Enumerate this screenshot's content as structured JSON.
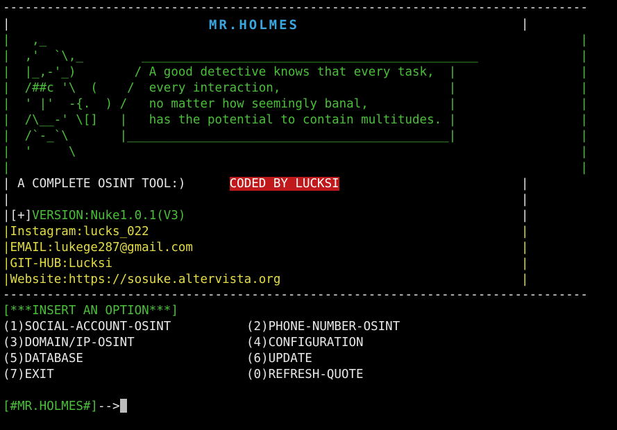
{
  "banner": {
    "border_top": "--------------------------------------------------------------------------------",
    "border_bottom": "--------------------------------------------------------------------------------",
    "title": "MR.HOLMES",
    "art_lines": [
      "|   ,_                                                                         |",
      "|  ,'  `\\,_        ______________________________________________              |",
      "|  |_,-'_)        / A good detective knows that every task,  |                 |",
      "|  /##c '\\  (    /  every interaction,                       |                 |",
      "|  ' |'  -{.  ) /   no matter how seemingly banal,           |                 |",
      "|  /\\__-' \\[]   |   has the potential to contain multitudes. |                 |",
      "|  /`-_`\\       |____________________________________________|                 |",
      "|  '     \\                                                                     |",
      "|                                                                              |"
    ],
    "tagline": "| A COMPLETE OSINT TOOL:)      ",
    "coded_by": "CODED BY LUCKSI",
    "blank_line": "|",
    "version_prefix": "|[+]",
    "version": "VERSION:Nuke1.0.1(V3)",
    "instagram": "|Instagram:lucks_022",
    "email": "|EMAIL:lukege287@gmail.com",
    "github": "|GIT-HUB:Lucksi",
    "website": "|Website:https://sosuke.altervista.org"
  },
  "menu": {
    "header": "[***INSERT AN OPTION***]",
    "options": [
      "(1)SOCIAL-ACCOUNT-OSINT",
      "(2)PHONE-NUMBER-OSINT",
      "(3)DOMAIN/IP-OSINT",
      "(4)CONFIGURATION",
      "(5)DATABASE",
      "(6)UPDATE",
      "(7)EXIT",
      "(0)REFRESH-QUOTE"
    ]
  },
  "prompt": {
    "label": "[#MR.HOLMES#]",
    "arrow": "-->"
  },
  "colors": {
    "background": "#000000",
    "text": "#e8e8e8",
    "green": "#4bbf3a",
    "yellow": "#e3dd45",
    "title": "#3aa6e0",
    "badge": "#c0191c"
  }
}
